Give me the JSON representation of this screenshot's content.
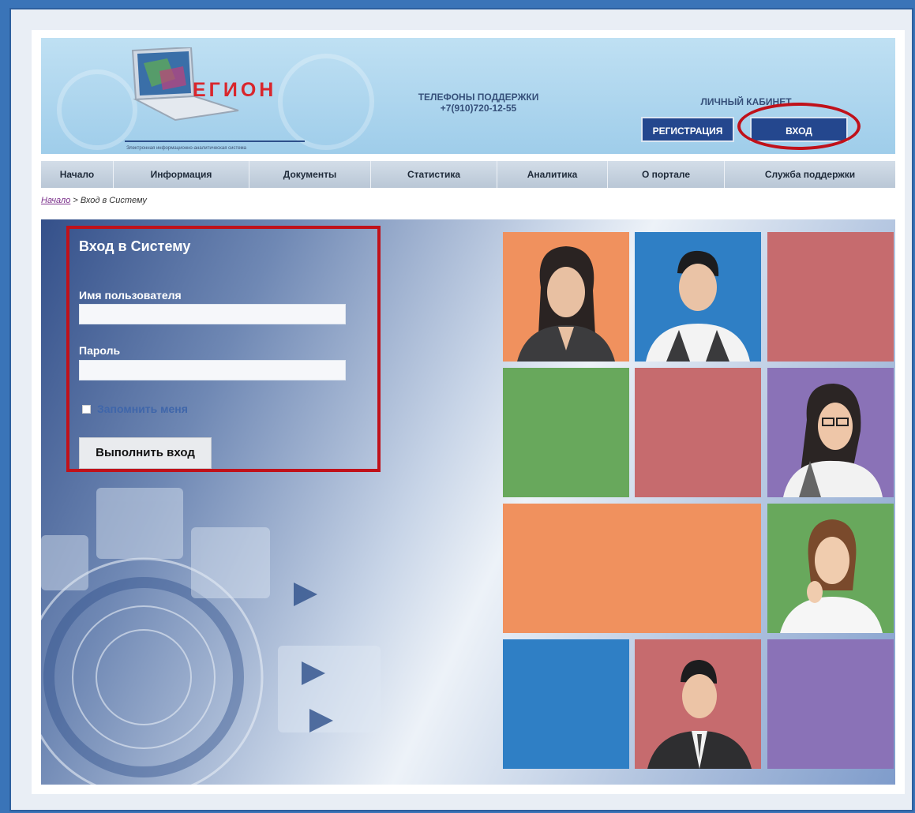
{
  "header": {
    "logo_text": "ЕГИОН",
    "logo_subtitle": "Электронная информационно-аналитическая система",
    "support_title": "ТЕЛЕФОНЫ ПОДДЕРЖКИ",
    "support_phone": "+7(910)720-12-55",
    "cabinet_title": "ЛИЧНЫЙ КАБИНЕТ",
    "register_label": "РЕГИСТРАЦИЯ",
    "login_label": "ВХОД"
  },
  "nav": {
    "items": [
      {
        "label": "Начало"
      },
      {
        "label": "Информация"
      },
      {
        "label": "Документы"
      },
      {
        "label": "Статистика"
      },
      {
        "label": "Аналитика"
      },
      {
        "label": "О портале"
      },
      {
        "label": "Служба поддержки"
      }
    ]
  },
  "breadcrumb": {
    "home": "Начало",
    "separator": " > ",
    "current": "Вход в Систему"
  },
  "login": {
    "title": "Вход в Систему",
    "username_label": "Имя пользователя",
    "username_value": "",
    "password_label": "Пароль",
    "password_value": "",
    "remember_label": "Запомнить меня",
    "remember_checked": false,
    "submit_label": "Выполнить вход"
  },
  "colors": {
    "orange": "#f0915e",
    "blue": "#2f7fc5",
    "red": "#c66b6e",
    "green": "#68a85c",
    "purple": "#8a72b7",
    "accent_red": "#c0111a",
    "button_blue": "#24478e"
  },
  "tiles": [
    {
      "color": "orange",
      "icon": "woman-avatar-icon"
    },
    {
      "color": "blue",
      "icon": "man-avatar-icon"
    },
    {
      "color": "red",
      "icon": ""
    },
    {
      "color": "green",
      "icon": ""
    },
    {
      "color": "red",
      "icon": ""
    },
    {
      "color": "purple",
      "icon": "woman-glasses-avatar-icon"
    },
    {
      "color": "orange",
      "icon": ""
    },
    {
      "color": "green",
      "icon": "woman-avatar-icon"
    },
    {
      "color": "blue",
      "icon": ""
    },
    {
      "color": "red",
      "icon": "businessman-avatar-icon"
    },
    {
      "color": "purple",
      "icon": ""
    }
  ]
}
